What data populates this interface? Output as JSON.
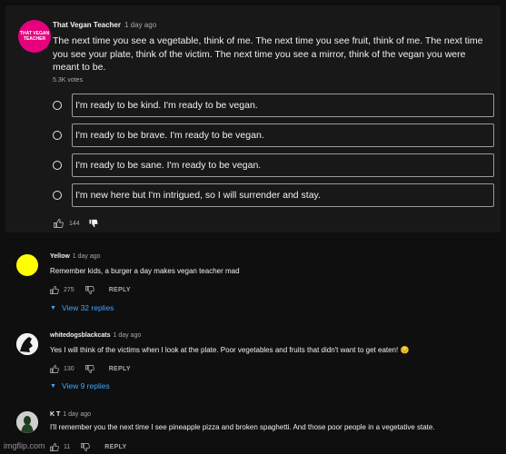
{
  "post": {
    "avatar_text": "THAT VEGAN TEACHER",
    "author": "That Vegan Teacher",
    "time": "1 day ago",
    "text": "The next time you see a vegetable, think of me. The next time you see fruit, think of me. The next time you see your plate, think of the victim. The next time you see a mirror, think of the vegan you were meant to be.",
    "votes": "5.3K votes",
    "options": [
      "I'm ready to be kind. I'm ready to be vegan.",
      "I'm ready to be brave. I'm ready to be vegan.",
      "I'm ready to be sane. I'm ready to be vegan.",
      "I'm new here but I'm intrigued, so I will surrender and stay."
    ],
    "likes": "144"
  },
  "comments": [
    {
      "author": "Yellow",
      "time": "1 day ago",
      "text": "Remember kids, a burger a day makes vegan teacher mad",
      "likes": "275",
      "reply_label": "REPLY",
      "view_replies": "View 32 replies"
    },
    {
      "author": "whitedogsblackcats",
      "time": "1 day ago",
      "text": "Yes I will think of the victims when I look at the plate. Poor vegetables and fruits that didn't want to get eaten! 😔",
      "likes": "130",
      "reply_label": "REPLY",
      "view_replies": "View 9 replies"
    },
    {
      "author": "K T",
      "time": "1 day ago",
      "text": "I'll remember you the next time I see pineapple pizza and broken spaghetti. And those poor people in a vegetative state.",
      "likes": "11",
      "reply_label": "REPLY"
    }
  ],
  "watermark": "imgflip.com",
  "colors": {
    "background": "#0f0f0f",
    "card": "#181818",
    "link_blue": "#3ea6ff",
    "avatar_pink": "#e6007e",
    "avatar_yellow": "#ffff00"
  }
}
